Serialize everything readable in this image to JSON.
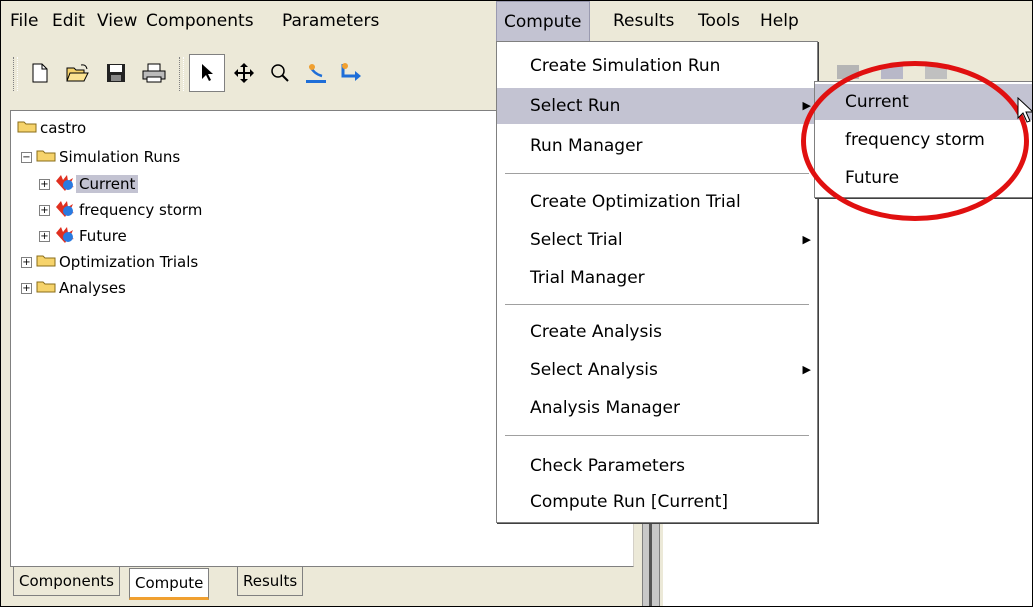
{
  "menubar": {
    "items": [
      {
        "label": "File"
      },
      {
        "label": "Edit"
      },
      {
        "label": "View"
      },
      {
        "label": "Components"
      },
      {
        "label": "Parameters"
      },
      {
        "label": "Compute"
      },
      {
        "label": "Results"
      },
      {
        "label": "Tools"
      },
      {
        "label": "Help"
      }
    ]
  },
  "toolbar": {
    "buttons": [
      "new-file-icon",
      "open-folder-icon",
      "save-icon",
      "print-icon",
      "select-arrow-icon",
      "pan-move-icon",
      "zoom-icon",
      "add-element-icon",
      "connect-icon"
    ]
  },
  "tree": {
    "root": "castro",
    "simulation_runs": "Simulation Runs",
    "runs": [
      "Current",
      "frequency storm",
      "Future"
    ],
    "optimization_trials": "Optimization Trials",
    "analyses": "Analyses",
    "selected": "Current"
  },
  "tabs": [
    "Components",
    "Compute",
    "Results"
  ],
  "active_tab": "Compute",
  "compute_menu": {
    "items": [
      {
        "label": "Create Simulation Run"
      },
      {
        "label": "Select Run",
        "submenu": true
      },
      {
        "label": "Run Manager"
      },
      {
        "label": "Create Optimization Trial"
      },
      {
        "label": "Select Trial",
        "submenu": true
      },
      {
        "label": "Trial Manager"
      },
      {
        "label": "Create Analysis"
      },
      {
        "label": "Select Analysis",
        "submenu": true
      },
      {
        "label": "Analysis Manager"
      },
      {
        "label": "Check Parameters"
      },
      {
        "label": "Compute Run [Current]"
      }
    ]
  },
  "select_run_submenu": {
    "items": [
      "Current",
      "frequency storm",
      "Future"
    ],
    "highlighted": "Current"
  },
  "colors": {
    "highlight": "#c3c3d2",
    "annotation_circle": "#e01010",
    "window_bg": "#ece9d8"
  }
}
